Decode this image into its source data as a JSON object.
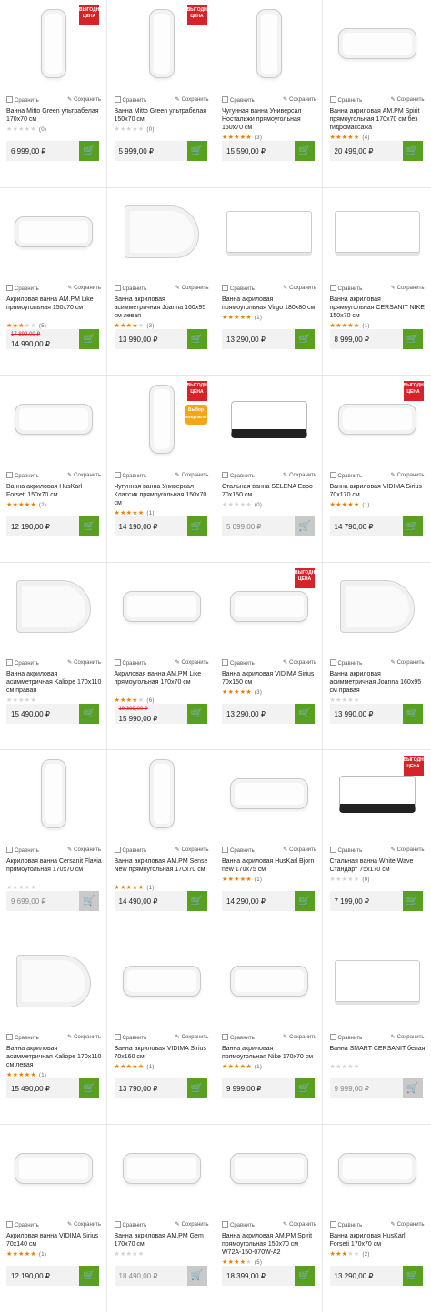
{
  "labels": {
    "compare": "Сравнить",
    "save": "Сохранить",
    "promo_red": "ВЫГОДНАЯ ЦЕНА",
    "promo_yellow": "Выбор покупателей"
  },
  "colors": {
    "star": "#f07c00",
    "cart_active": "#57a11f",
    "cart_disabled": "#c9c9c9",
    "old_price": "#d8222a",
    "promo_red": "#d8222a",
    "promo_yellow": "#f3a712"
  },
  "products": [
    {
      "title": "Ванна Mitto Green ультрабелая 170х70 см",
      "price": "6 999,00 ₽",
      "rating": 0,
      "reviews": "(0)",
      "available": true,
      "image": "tub-v",
      "promo": "red"
    },
    {
      "title": "Ванна Mitto Green ультрабелая 150х70 см",
      "price": "5 999,00 ₽",
      "rating": 0,
      "reviews": "(0)",
      "available": true,
      "image": "tub-v",
      "promo": "red"
    },
    {
      "title": "Чугунная ванна Универсал Ностальжи прямоугольная 150х70 см",
      "price": "15 590,00 ₽",
      "rating": 5,
      "reviews": "(3)",
      "available": true,
      "image": "tub-v"
    },
    {
      "title": "Ванна акриловая AM.PM Spirit прямоугольная 170х70 см без гидромассажа",
      "price": "20 499,00 ₽",
      "rating": 5,
      "reviews": "(4)",
      "available": true,
      "image": "tub-h"
    },
    {
      "title": "Акриловая ванна AM.PM Like прямоугольная 150х70 см",
      "old_price": "17 899,00 ₽",
      "price": "14 990,00 ₽",
      "rating": 3.5,
      "reviews": "(5)",
      "available": true,
      "image": "tub-h"
    },
    {
      "title": "Ванна акриловая асимметричная Joanna 160х95 см левая",
      "price": "13 990,00 ₽",
      "rating": 4.5,
      "reviews": "(3)",
      "available": true,
      "image": "corner"
    },
    {
      "title": "Ванна акриловая прямоугольная Virgo 180х80 см",
      "price": "13 290,00 ₽",
      "rating": 5,
      "reviews": "(1)",
      "available": true,
      "image": "panel"
    },
    {
      "title": "Ванна акриловая прямоугольная CERSANIT NIKE 150х70 см",
      "price": "8 999,00 ₽",
      "rating": 5,
      "reviews": "(1)",
      "available": true,
      "image": "panel"
    },
    {
      "title": "Ванна акриловая HusKarl Forseti 150х70 см",
      "price": "12 190,00 ₽",
      "rating": 5,
      "reviews": "(2)",
      "available": true,
      "image": "tub-h"
    },
    {
      "title": "Чугунная ванна Универсал Классик прямоугольная 150х70 см",
      "price": "14 190,00 ₽",
      "rating": 5,
      "reviews": "(1)",
      "available": true,
      "image": "tub-v",
      "promo": "red-yellow"
    },
    {
      "title": "Стальная ванна SELENA Евро 70х150 см",
      "price": "5 099,00 ₽",
      "rating": 0,
      "reviews": "(0)",
      "available": false,
      "image": "steel"
    },
    {
      "title": "Ванна акриловая VIDIMA Sirius 70х170 см",
      "price": "14 790,00 ₽",
      "rating": 5,
      "reviews": "(1)",
      "available": true,
      "image": "tub-h",
      "promo": "red"
    },
    {
      "title": "Ванна акриловая асимметричная Kaliope 170х110 см правая",
      "price": "15 490,00 ₽",
      "rating": 0,
      "reviews": "",
      "available": true,
      "image": "corner"
    },
    {
      "title": "Акриловая ванна AM.PM Like прямоугольная 170х70 см",
      "old_price": "19 399,00 ₽",
      "price": "15 990,00 ₽",
      "rating": 4.5,
      "reviews": "(6)",
      "available": true,
      "image": "tub-h"
    },
    {
      "title": "Ванна акриловая VIDIMA Sirius 70х150 см",
      "price": "13 290,00 ₽",
      "rating": 5,
      "reviews": "(3)",
      "available": true,
      "image": "tub-h",
      "promo": "red"
    },
    {
      "title": "Ванна акриловая асимметричная Joanna 160х95 см правая",
      "price": "13 990,00 ₽",
      "rating": 0,
      "reviews": "",
      "available": true,
      "image": "corner"
    },
    {
      "title": "Акриловая ванна Cersanit Flavia прямоугольная 170х70 см",
      "price": "9 699,00 ₽",
      "rating": 0,
      "reviews": "",
      "available": false,
      "image": "tub-v"
    },
    {
      "title": "Ванна акриловая AM.PM Sense New прямоугольная 170х70 см",
      "price": "14 490,00 ₽",
      "rating": 5,
      "reviews": "(1)",
      "available": true,
      "image": "tub-v"
    },
    {
      "title": "Ванна акриловая HusKarl Bjorn new 170х75 см",
      "price": "14 290,00 ₽",
      "rating": 5,
      "reviews": "(1)",
      "available": true,
      "image": "tub-h"
    },
    {
      "title": "Стальная ванна White Wave Стандарт 75х170 см",
      "price": "7 199,00 ₽",
      "rating": 0,
      "reviews": "(0)",
      "available": true,
      "image": "steel",
      "promo": "red"
    },
    {
      "title": "Ванна акриловая асимметричная Kaliope 170х110 см левая",
      "price": "15 490,00 ₽",
      "rating": 5,
      "reviews": "(1)",
      "available": true,
      "image": "corner"
    },
    {
      "title": "Ванна акриловая VIDIMA Sirius 70х160 см",
      "price": "13 790,00 ₽",
      "rating": 5,
      "reviews": "(1)",
      "available": true,
      "image": "tub-h"
    },
    {
      "title": "Ванна акриловая прямоугольная Nike 170х70 см",
      "price": "9 999,00 ₽",
      "rating": 5,
      "reviews": "(1)",
      "available": true,
      "image": "tub-h"
    },
    {
      "title": "Ванна SMART CERSANIT белая",
      "price": "9 999,00 ₽",
      "rating": 0,
      "reviews": "",
      "available": false,
      "image": "panel"
    },
    {
      "title": "Акриловая ванна VIDIMA Sirius 70х140 см",
      "price": "12 190,00 ₽",
      "rating": 5,
      "reviews": "(1)",
      "available": true,
      "image": "tub-h"
    },
    {
      "title": "Ванна акриловая AM.PM Gem 170х70 см",
      "price": "18 490,00 ₽",
      "rating": 0,
      "reviews": "",
      "available": false,
      "image": "tub-h"
    },
    {
      "title": "Ванна акриловая AM.PM Spirit прямоугольная 150х70 см W72A-150-070W-A2",
      "price": "18 399,00 ₽",
      "rating": 4.5,
      "reviews": "(5)",
      "available": true,
      "image": "tub-h"
    },
    {
      "title": "Ванна акриловая HusKarl Forseti 170х70 см",
      "price": "13 290,00 ₽",
      "rating": 3,
      "reviews": "(2)",
      "available": true,
      "image": "tub-h"
    }
  ]
}
